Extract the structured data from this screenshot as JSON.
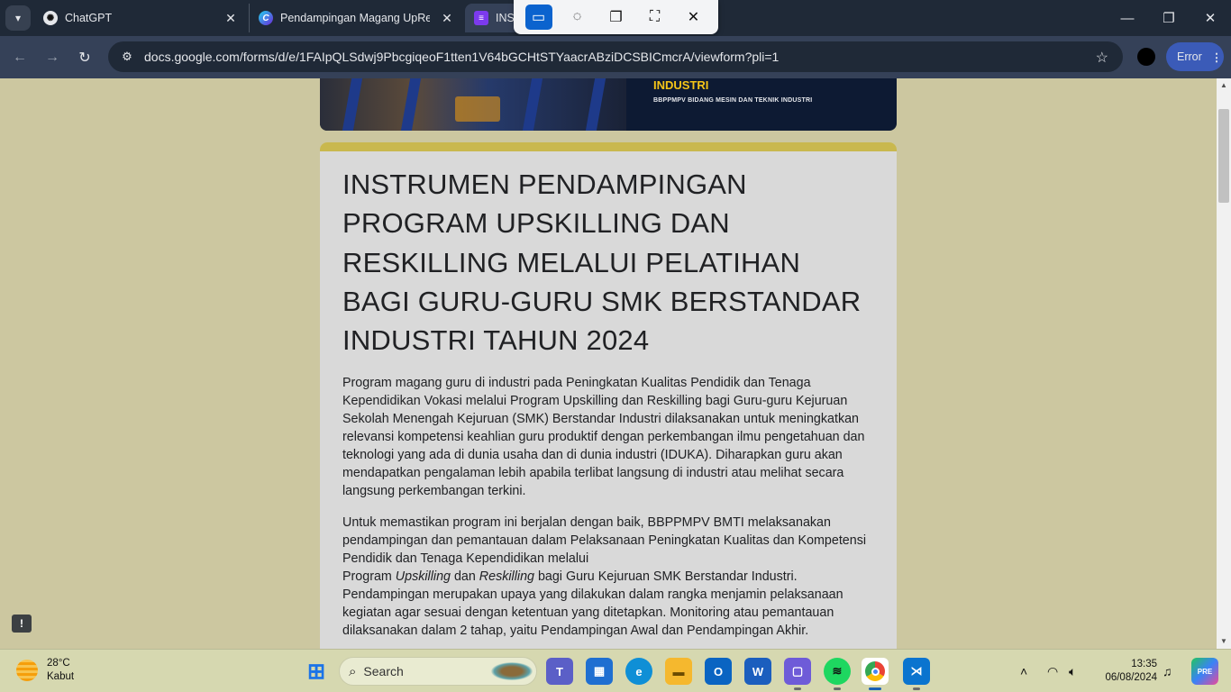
{
  "browser": {
    "tabs": [
      {
        "label": "ChatGPT",
        "icon": "chatgpt-icon"
      },
      {
        "label": "Pendampingan Magang UpRe",
        "icon": "c-app-icon"
      },
      {
        "label": "INST",
        "icon": "google-forms-icon"
      }
    ],
    "url": "docs.google.com/forms/d/e/1FAIpQLSdwj9PbcgiqeoF1tten1V64bGCHtSTYaacrABziDCSBICmcrA/viewform?pli=1",
    "error_button_label": "Error",
    "snip_tools": [
      "rectangle-snip-icon",
      "freeform-snip-icon",
      "window-snip-icon",
      "fullscreen-snip-icon",
      "close-icon"
    ]
  },
  "banner": {
    "heading": "INDUSTRI",
    "subheading": "BBPPMPV BIDANG MESIN DAN TEKNIK INDUSTRI"
  },
  "form": {
    "title": "INSTRUMEN PENDAMPINGAN PROGRAM UPSKILLING DAN RESKILLING MELALUI PELATIHAN BAGI GURU-GURU SMK BERSTANDAR INDUSTRI TAHUN 2024",
    "paragraph1": "Program magang guru di industri pada Peningkatan Kualitas Pendidik dan Tenaga Kependidikan Vokasi melalui Program Upskilling dan Reskilling bagi Guru-guru Kejuruan Sekolah Menengah Kejuruan (SMK) Berstandar Industri dilaksanakan untuk meningkatkan relevansi kompetensi keahlian guru produktif dengan perkembangan ilmu pengetahuan dan teknologi yang ada di dunia usaha dan di dunia industri (IDUKA). Diharapkan guru akan mendapatkan pengalaman lebih apabila terlibat langsung di industri atau melihat secara langsung perkembangan terkini.",
    "paragraph2": {
      "line1": "Untuk memastikan program ini berjalan dengan baik, BBPPMPV BMTI melaksanakan pendampingan dan pemantauan dalam Pelaksanaan Peningkatan Kualitas dan Kompetensi Pendidik dan Tenaga Kependidikan melalui",
      "prefix": "Program ",
      "italic1": "Upskilling",
      "middle": " dan ",
      "italic2": "Reskilling",
      "rest": " bagi Guru Kejuruan SMK Berstandar Industri. Pendampingan merupakan upaya yang dilakukan dalam rangka menjamin pelaksanaan kegiatan agar sesuai dengan ketentuan yang ditetapkan. Monitoring atau pemantauan dilaksanakan dalam 2 tahap, yaitu Pendampingan Awal dan Pendampingan Akhir."
    }
  },
  "taskbar": {
    "weather_temp": "28°C",
    "weather_desc": "Kabut",
    "search_placeholder": "Search",
    "time": "13:35",
    "date": "06/08/2024",
    "apps": [
      "windows-start-icon",
      "teams-icon",
      "microsoft-store-icon",
      "edge-icon",
      "file-explorer-icon",
      "outlook-new-icon",
      "word-icon",
      "app-icon",
      "spotify-icon",
      "chrome-icon",
      "vscode-icon"
    ]
  },
  "colors": {
    "page_bg": "#ccc7a0",
    "card_bg": "#d9d9d9",
    "accent": "#c9b84e",
    "browser_dark": "#1f2937",
    "toolbar": "#354158"
  }
}
